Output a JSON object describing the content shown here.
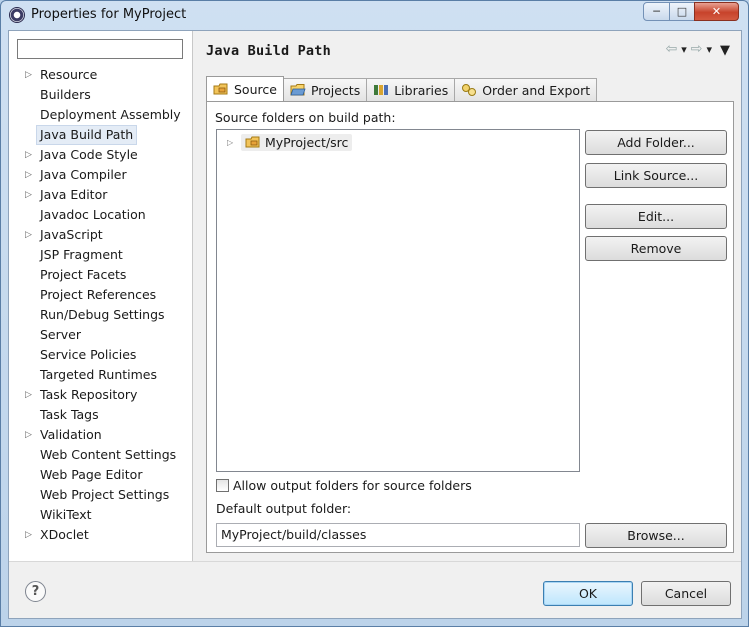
{
  "window": {
    "title": "Properties for MyProject"
  },
  "nav": {
    "filter_value": "",
    "items": [
      {
        "label": "Resource",
        "expandable": true
      },
      {
        "label": "Builders",
        "expandable": false
      },
      {
        "label": "Deployment Assembly",
        "expandable": false
      },
      {
        "label": "Java Build Path",
        "expandable": false,
        "selected": true
      },
      {
        "label": "Java Code Style",
        "expandable": true
      },
      {
        "label": "Java Compiler",
        "expandable": true
      },
      {
        "label": "Java Editor",
        "expandable": true
      },
      {
        "label": "Javadoc Location",
        "expandable": false
      },
      {
        "label": "JavaScript",
        "expandable": true
      },
      {
        "label": "JSP Fragment",
        "expandable": false
      },
      {
        "label": "Project Facets",
        "expandable": false
      },
      {
        "label": "Project References",
        "expandable": false
      },
      {
        "label": "Run/Debug Settings",
        "expandable": false
      },
      {
        "label": "Server",
        "expandable": false
      },
      {
        "label": "Service Policies",
        "expandable": false
      },
      {
        "label": "Targeted Runtimes",
        "expandable": false
      },
      {
        "label": "Task Repository",
        "expandable": true
      },
      {
        "label": "Task Tags",
        "expandable": false
      },
      {
        "label": "Validation",
        "expandable": true
      },
      {
        "label": "Web Content Settings",
        "expandable": false
      },
      {
        "label": "Web Page Editor",
        "expandable": false
      },
      {
        "label": "Web Project Settings",
        "expandable": false
      },
      {
        "label": "WikiText",
        "expandable": false
      },
      {
        "label": "XDoclet",
        "expandable": true
      }
    ]
  },
  "page": {
    "title": "Java Build Path",
    "tabs": [
      {
        "label": "Source",
        "icon": "source-folder-icon",
        "active": true
      },
      {
        "label": "Projects",
        "icon": "project-folder-icon"
      },
      {
        "label": "Libraries",
        "icon": "libraries-icon"
      },
      {
        "label": "Order and Export",
        "icon": "order-export-icon"
      }
    ],
    "source_label": "Source folders on build path:",
    "tree": {
      "node_label": "MyProject/src"
    },
    "buttons": {
      "add_folder": "Add Folder...",
      "link_source": "Link Source...",
      "edit": "Edit...",
      "remove": "Remove",
      "browse": "Browse..."
    },
    "allow_output_label": "Allow output folders for source folders",
    "allow_output_checked": false,
    "default_output_label": "Default output folder:",
    "default_output_value": "MyProject/build/classes"
  },
  "footer": {
    "ok_label": "OK",
    "cancel_label": "Cancel"
  }
}
